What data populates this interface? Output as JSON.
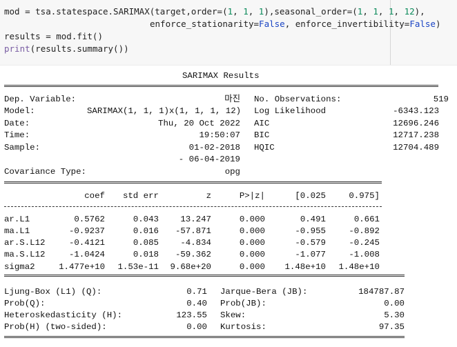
{
  "code": {
    "line1": {
      "prefix": "mod = tsa.statespace.SARIMAX(target,order=(",
      "order": [
        "1",
        "1",
        "1"
      ],
      "mid": "),seasonal_order=(",
      "seasonal": [
        "1",
        "1",
        "1",
        "12"
      ],
      "suffix": "),"
    },
    "line2": {
      "kw1": "enforce_stationarity",
      "val1": "False",
      "kw2": "enforce_invertibility",
      "val2": "False",
      "close": ")"
    },
    "line3": "results = mod.fit()",
    "line4": {
      "fn": "print",
      "arg": "(results.summary())"
    }
  },
  "summary": {
    "title": "SARIMAX Results",
    "dep_variable_label": "Dep. Variable:",
    "dep_variable_value": "마진",
    "model_label": "Model:",
    "model_value": "SARIMAX(1, 1, 1)x(1, 1, 1, 12)",
    "date_label": "Date:",
    "date_value": "Thu, 20 Oct 2022",
    "time_label": "Time:",
    "time_value": "19:50:07",
    "sample_label": "Sample:",
    "sample_value_start": "01-02-2018",
    "sample_value_end": "- 06-04-2019",
    "cov_label": "Covariance Type:",
    "cov_value": "opg",
    "right_stats": [
      {
        "label": "No. Observations:",
        "value": "519"
      },
      {
        "label": "Log Likelihood",
        "value": "-6343.123"
      },
      {
        "label": "AIC",
        "value": "12696.246"
      },
      {
        "label": "BIC",
        "value": "12717.238"
      },
      {
        "label": "HQIC",
        "value": "12704.489"
      }
    ]
  },
  "coef_table": {
    "headers": [
      "coef",
      "std err",
      "z",
      "P>|z|",
      "[0.025",
      "0.975]"
    ],
    "rows": [
      {
        "name": "ar.L1",
        "values": [
          "0.5762",
          "0.043",
          "13.247",
          "0.000",
          "0.491",
          "0.661"
        ]
      },
      {
        "name": "ma.L1",
        "values": [
          "-0.9237",
          "0.016",
          "-57.871",
          "0.000",
          "-0.955",
          "-0.892"
        ]
      },
      {
        "name": "ar.S.L12",
        "values": [
          "-0.4121",
          "0.085",
          "-4.834",
          "0.000",
          "-0.579",
          "-0.245"
        ]
      },
      {
        "name": "ma.S.L12",
        "values": [
          "-1.0424",
          "0.018",
          "-59.362",
          "0.000",
          "-1.077",
          "-1.008"
        ]
      },
      {
        "name": "sigma2",
        "values": [
          "1.477e+10",
          "1.53e-11",
          "9.68e+20",
          "0.000",
          "1.48e+10",
          "1.48e+10"
        ]
      }
    ]
  },
  "diagnostics": {
    "rows": [
      {
        "l_label": "Ljung-Box (L1) (Q):",
        "l_value": "0.71",
        "r_label": "Jarque-Bera (JB):",
        "r_value": "184787.87"
      },
      {
        "l_label": "Prob(Q):",
        "l_value": "0.40",
        "r_label": "Prob(JB):",
        "r_value": "0.00"
      },
      {
        "l_label": "Heteroskedasticity (H):",
        "l_value": "123.55",
        "r_label": "Skew:",
        "r_value": "5.30"
      },
      {
        "l_label": "Prob(H) (two-sided):",
        "l_value": "0.00",
        "r_label": "Kurtosis:",
        "r_value": "97.35"
      }
    ]
  }
}
